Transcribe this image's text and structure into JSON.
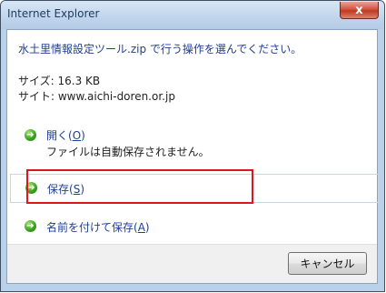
{
  "window": {
    "title": "Internet Explorer",
    "close_glyph": "x"
  },
  "prompt": "水土里情報設定ツール.zip で行う操作を選んでください。",
  "info": {
    "size_line": "サイズ: 16.3 KB",
    "site_line": "サイト: www.aichi-doren.or.jp"
  },
  "options": [
    {
      "label_prefix": "開く(",
      "hotkey": "O",
      "label_suffix": ")",
      "description": "ファイルは自動保存されません。",
      "icon": "green-arrow-icon"
    },
    {
      "label_prefix": "保存(",
      "hotkey": "S",
      "label_suffix": ")",
      "icon": "green-arrow-icon"
    },
    {
      "label_prefix": "名前を付けて保存(",
      "hotkey": "A",
      "label_suffix": ")",
      "icon": "green-arrow-icon"
    }
  ],
  "arrow_glyph": "➔",
  "footer": {
    "cancel_label": "キャンセル"
  },
  "colors": {
    "link_blue": "#1f3e96",
    "highlight_red": "#e0141d",
    "close_red": "#c1381f"
  }
}
